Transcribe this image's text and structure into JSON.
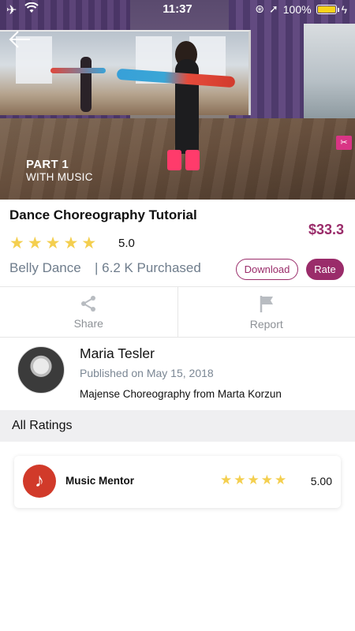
{
  "status_bar": {
    "time": "11:37",
    "battery_percent": "100%",
    "battery_level": 1.0
  },
  "hero": {
    "part_title": "PART 1",
    "part_subtitle": "WITH MUSIC"
  },
  "course": {
    "title": "Dance Choreography Tutorial",
    "price": "$33.3",
    "rating_value": "5.0",
    "stars": 5,
    "category": "Belly Dance",
    "purchased": "| 6.2 K Purchased",
    "download_label": "Download",
    "rate_label": "Rate"
  },
  "actions": {
    "share_label": "Share",
    "report_label": "Report"
  },
  "author": {
    "name": "Maria Tesler",
    "published": "Published on May 15, 2018",
    "description": "Majense Choreography from Marta Korzun"
  },
  "ratings_section": {
    "header": "All Ratings",
    "items": [
      {
        "name": "Music Mentor",
        "stars": 5,
        "value": "5.00"
      }
    ]
  },
  "colors": {
    "accent": "#9a2c6a",
    "star": "#f4cf4f",
    "muted_text": "#6f7d8c",
    "section_bg": "#efeff1",
    "reviewer_avatar": "#d13a2a"
  }
}
